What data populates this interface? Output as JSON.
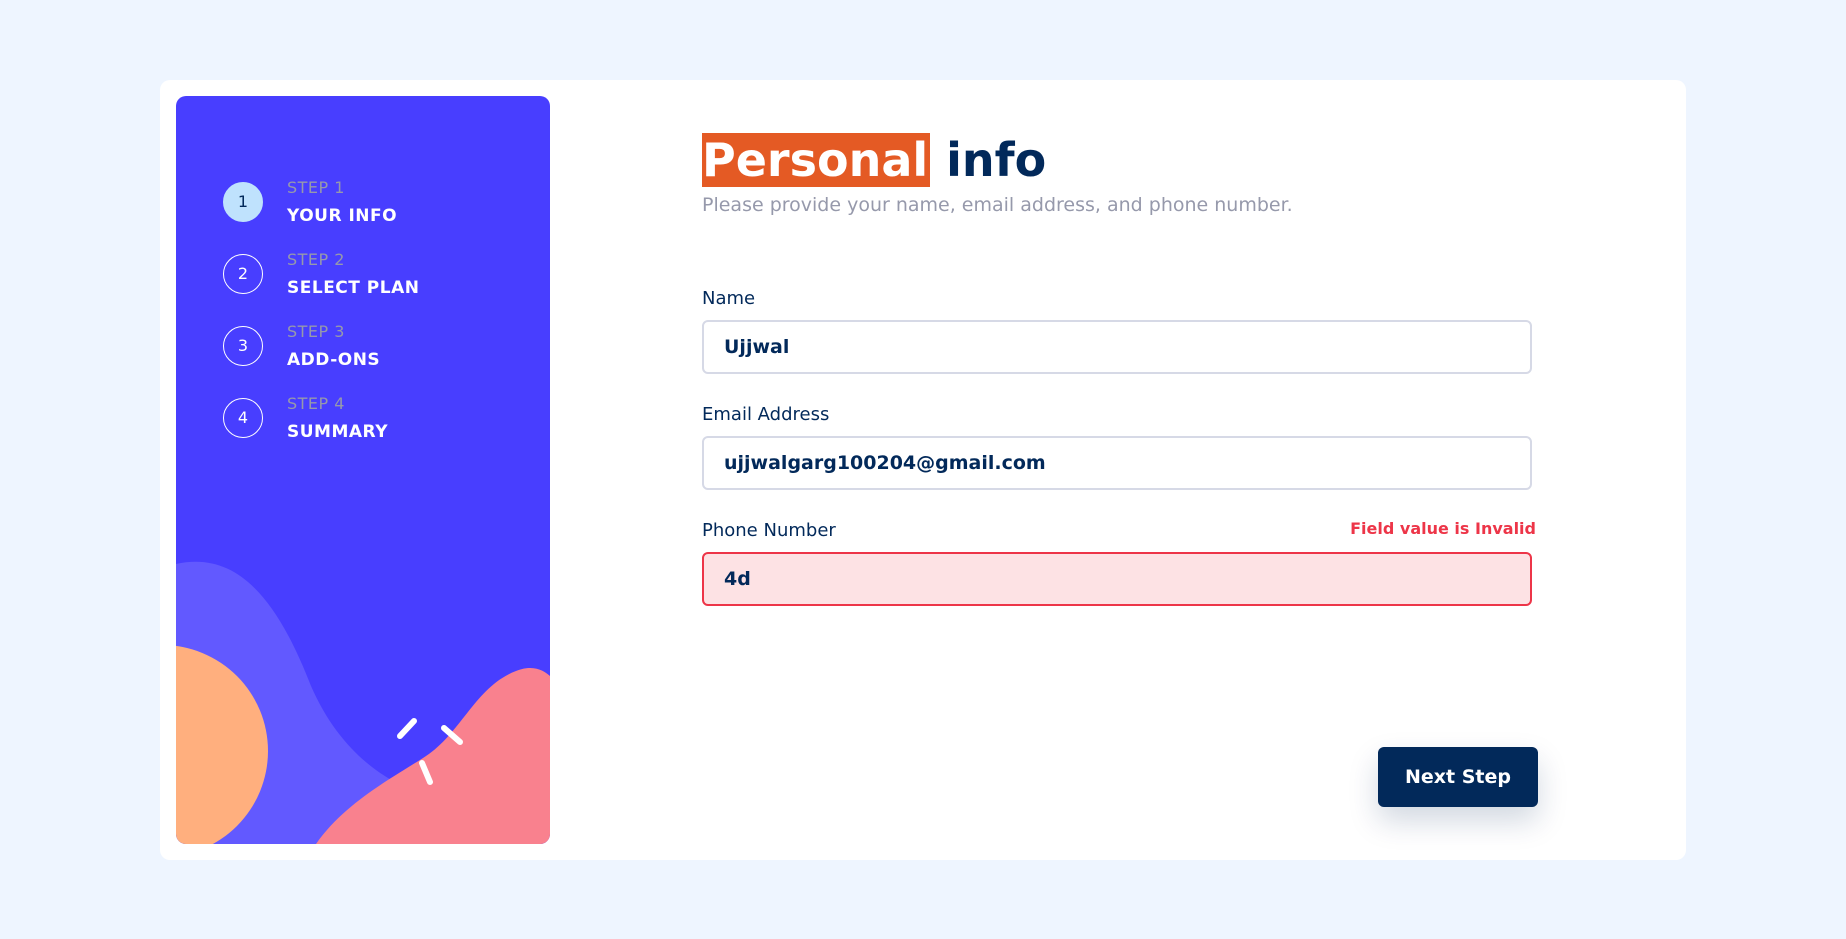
{
  "sidebar": {
    "steps": [
      {
        "number": "1",
        "sub": "STEP 1",
        "title": "YOUR INFO",
        "active": true
      },
      {
        "number": "2",
        "sub": "STEP 2",
        "title": "SELECT PLAN",
        "active": false
      },
      {
        "number": "3",
        "sub": "STEP 3",
        "title": "ADD-ONS",
        "active": false
      },
      {
        "number": "4",
        "sub": "STEP 4",
        "title": "SUMMARY",
        "active": false
      }
    ]
  },
  "main": {
    "title_highlight": "Personal",
    "title_rest": " info",
    "subtitle": "Please provide your name, email address, and phone number.",
    "fields": {
      "name": {
        "label": "Name",
        "value": "Ujjwal"
      },
      "email": {
        "label": "Email Address",
        "value": "ujjwalgarg100204@gmail.com"
      },
      "phone": {
        "label": "Phone Number",
        "value": "4d",
        "error": "Field value is Invalid"
      }
    },
    "next_button": "Next Step"
  },
  "colors": {
    "sidebar_bg": "#483eff",
    "active_step": "#bfe2fd",
    "title_highlight": "#e45a24",
    "error": "#ed3548",
    "button": "#02295a"
  }
}
